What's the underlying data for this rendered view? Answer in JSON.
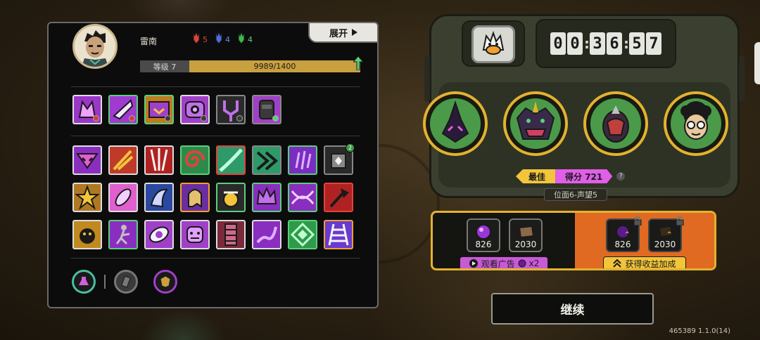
{
  "player": {
    "name": "雷南",
    "level_label": "等级 7",
    "xp_text": "9989/1400",
    "keys": [
      {
        "color": "#e2433a",
        "count": "5"
      },
      {
        "color": "#4a70e0",
        "count": "4"
      },
      {
        "color": "#3fb84a",
        "count": "4"
      }
    ],
    "expand_label": "展开"
  },
  "equipment": [
    {
      "icon": "claw-beast-icon",
      "border": "b-white",
      "bg": "#9a36c8"
    },
    {
      "icon": "slash-fist-icon",
      "border": "b-green",
      "bg": "#a03ad0"
    },
    {
      "icon": "vault-icon",
      "border": "b-green",
      "bg": "#c07a20"
    },
    {
      "icon": "eye-device-icon",
      "border": "b-white",
      "bg": "#a040c8"
    },
    {
      "icon": "trident-icon",
      "border": "b-gray",
      "bg": "#2a2a2a"
    },
    {
      "icon": "bag-icon",
      "border": "b-gray",
      "bg": "#a040c8"
    }
  ],
  "skills": [
    {
      "icon": "mask-icon",
      "border": "b-white",
      "bg": "#8a2ec0"
    },
    {
      "icon": "spark-icon",
      "border": "b-white",
      "bg": "#c03a2a"
    },
    {
      "icon": "blades-icon",
      "border": "b-white",
      "bg": "#b02222"
    },
    {
      "icon": "spiral-icon",
      "border": "b-green",
      "bg": "#2e8a4a"
    },
    {
      "icon": "slash-icon",
      "border": "b-red",
      "bg": "#2e9a6a"
    },
    {
      "icon": "wave-icon",
      "border": "b-gray",
      "bg": "#2e9a6a"
    },
    {
      "icon": "claw-icon",
      "border": "b-green",
      "bg": "#7a2ec0"
    },
    {
      "icon": "chest-icon",
      "border": "b-gray",
      "bg": "#2a2a2a",
      "badge": "2"
    },
    {
      "icon": "burst-icon",
      "border": "b-white",
      "bg": "#b07820"
    },
    {
      "icon": "feather-icon",
      "border": "b-white",
      "bg": "#e060d0"
    },
    {
      "icon": "shadow-icon",
      "border": "b-white",
      "bg": "#2a48a0"
    },
    {
      "icon": "ghost-icon",
      "border": "b-orange",
      "bg": "#6a2ea0"
    },
    {
      "icon": "orb-icon",
      "border": "b-green",
      "bg": "#2a2a2a"
    },
    {
      "icon": "crown-icon",
      "border": "b-green",
      "bg": "#8a2ec0"
    },
    {
      "icon": "vortex-icon",
      "border": "b-green",
      "bg": "#8a2ec0"
    },
    {
      "icon": "axe-icon",
      "border": "b-red",
      "bg": "#b02222"
    },
    {
      "icon": "bomb-icon",
      "border": "b-white",
      "bg": "#c08a20"
    },
    {
      "icon": "dancer-icon",
      "border": "b-green",
      "bg": "#8a2ec0"
    },
    {
      "icon": "eye-icon",
      "border": "b-white",
      "bg": "#a040c8"
    },
    {
      "icon": "face-icon",
      "border": "b-white",
      "bg": "#a040c8"
    },
    {
      "icon": "scroll-icon",
      "border": "b-white",
      "bg": "#7a2a3a"
    },
    {
      "icon": "tentacle-icon",
      "border": "b-white",
      "bg": "#8a2ec0"
    },
    {
      "icon": "diamond-icon",
      "border": "b-green",
      "bg": "#2e9a4a"
    },
    {
      "icon": "ladder-icon",
      "border": "b-orange",
      "bg": "#6a3ad0"
    }
  ],
  "bottom_tabs": [
    {
      "icon": "potion-icon",
      "ring": "#4ac0a0"
    },
    {
      "icon": "book-icon",
      "ring": "#777"
    },
    {
      "icon": "emblem-icon",
      "ring": "#a040c8"
    }
  ],
  "timer": {
    "d1": "0",
    "d2": "0",
    "d3": "3",
    "d4": "6",
    "d5": "5",
    "d6": "7"
  },
  "bosses": [
    {
      "icon": "spike-beast-icon",
      "bg": "#4a9a4a"
    },
    {
      "icon": "jaw-beast-icon",
      "bg": "#4a9a4a"
    },
    {
      "icon": "armored-beast-icon",
      "bg": "#4a9a4a"
    },
    {
      "icon": "glasses-kid-icon",
      "bg": "#4a9a4a"
    }
  ],
  "score": {
    "best_label": "最佳",
    "score_text": "得分 721",
    "help": "?"
  },
  "location": "位面6-声望5",
  "rewards": {
    "free": [
      {
        "icon": "purple-orb-icon",
        "value": "826"
      },
      {
        "icon": "brown-book-icon",
        "value": "2030"
      }
    ],
    "bonus": [
      {
        "icon": "purple-orb-icon",
        "value": "826"
      },
      {
        "icon": "brown-book-icon",
        "value": "2030"
      }
    ],
    "ad_label": "观看广告",
    "ad_multiplier": "x2",
    "bonus_label": "获得收益加成"
  },
  "continue_label": "继续",
  "version": "465389 1.1.0(14)"
}
